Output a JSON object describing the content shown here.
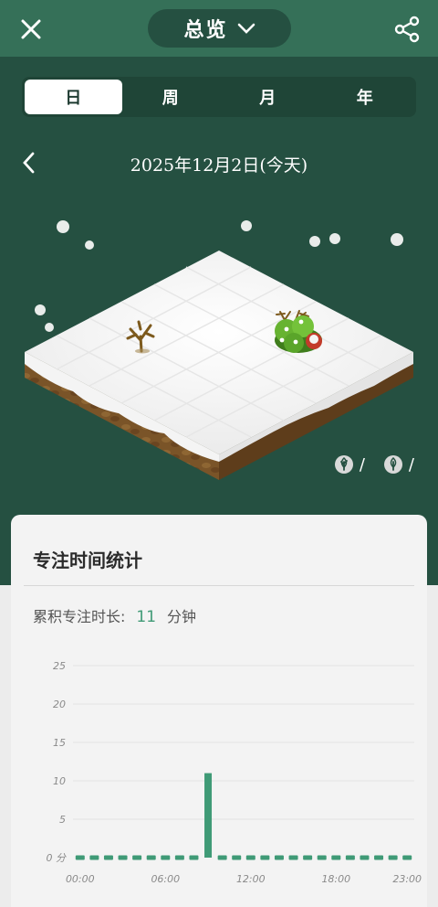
{
  "header": {
    "title": "总览",
    "close_icon": "close-icon",
    "share_icon": "share-icon",
    "dropdown_icon": "chevron-down-icon"
  },
  "tabs": [
    {
      "label": "日",
      "active": true
    },
    {
      "label": "周",
      "active": false
    },
    {
      "label": "月",
      "active": false
    },
    {
      "label": "年",
      "active": false
    }
  ],
  "date": {
    "text": "2025年12月2日(今天)"
  },
  "counts": {
    "healthy": "/",
    "withered": "/"
  },
  "stats": {
    "title": "专注时间统计",
    "total_label": "累积专注时长:",
    "total_value": "11",
    "total_unit": "分钟"
  },
  "colors": {
    "dark_green": "#255041",
    "header_green": "#357058",
    "accent": "#3f9a76",
    "card": "#f3f3f3"
  },
  "chart_data": {
    "type": "bar",
    "ylabel": "分",
    "ylim": [
      0,
      25
    ],
    "yticks": [
      "0",
      "5",
      "10",
      "15",
      "20",
      "25"
    ],
    "xticks": [
      "00:00",
      "06:00",
      "12:00",
      "18:00",
      "23:00"
    ],
    "x": [
      0,
      1,
      2,
      3,
      4,
      5,
      6,
      7,
      8,
      9,
      10,
      11,
      12,
      13,
      14,
      15,
      16,
      17,
      18,
      19,
      20,
      21,
      22,
      23
    ],
    "values": [
      0,
      0,
      0,
      0,
      0,
      0,
      0,
      0,
      0,
      11,
      0,
      0,
      0,
      0,
      0,
      0,
      0,
      0,
      0,
      0,
      0,
      0,
      0,
      0
    ]
  }
}
